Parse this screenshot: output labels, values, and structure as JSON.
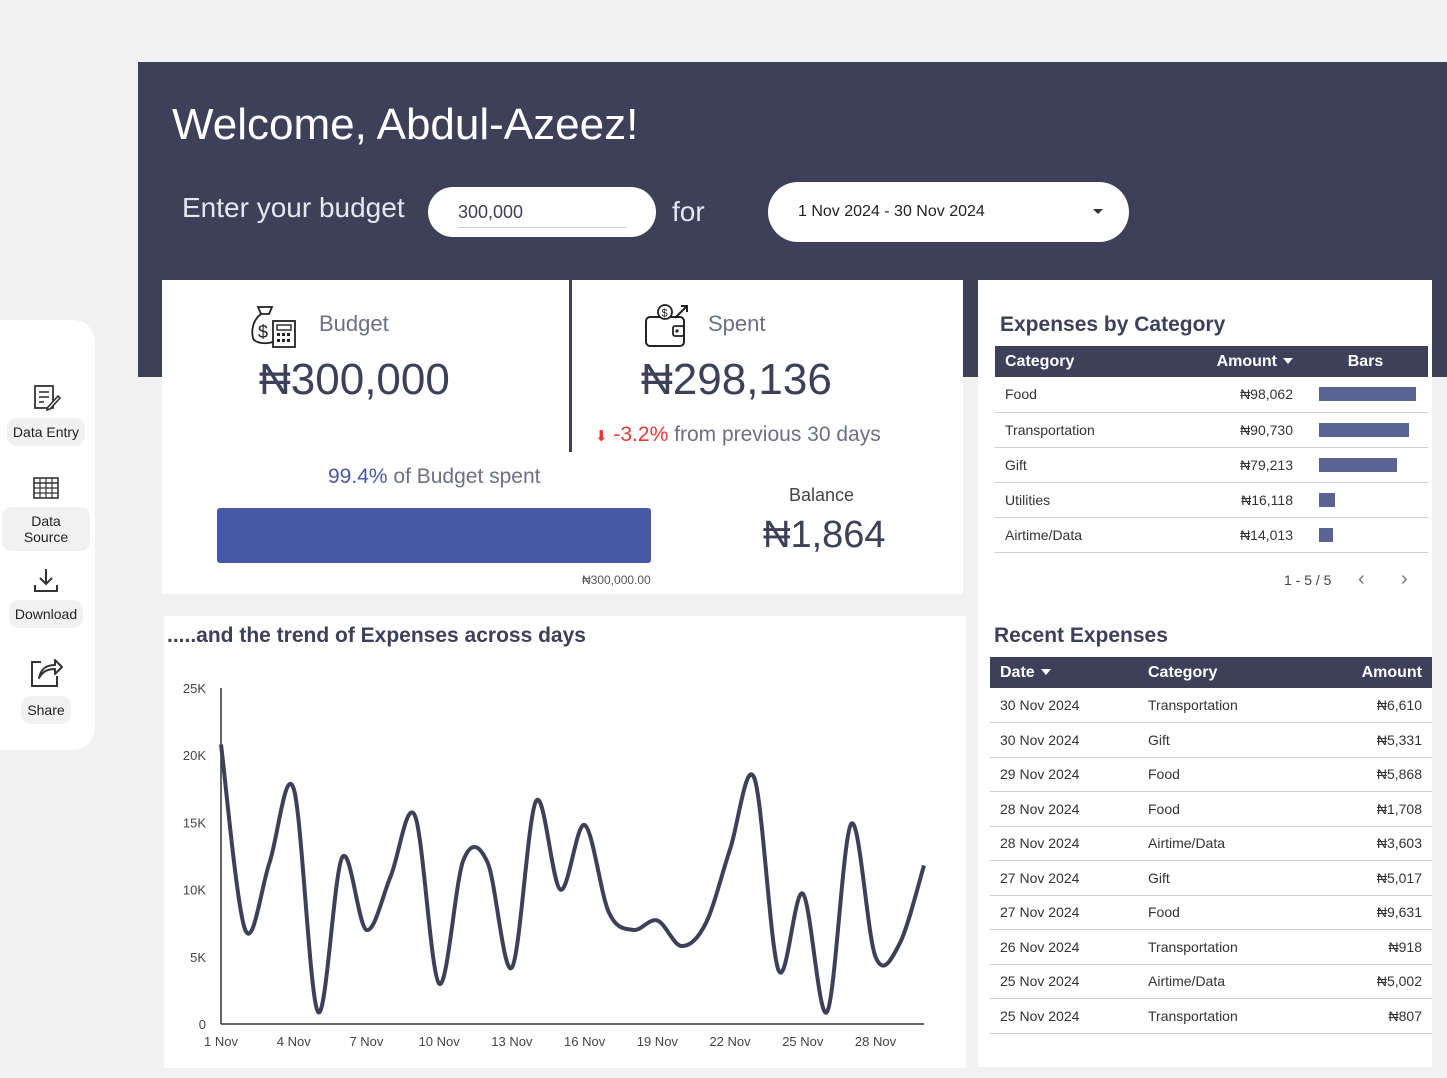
{
  "header": {
    "welcome": "Welcome, Abdul-Azeez!",
    "budget_prompt": "Enter your budget",
    "budget_value": "300,000",
    "for_label": "for",
    "date_range": "1 Nov 2024 - 30 Nov 2024"
  },
  "sidebar": {
    "items": [
      {
        "label": "Data Entry",
        "icon": "data-entry-icon"
      },
      {
        "label": "Data Source",
        "icon": "table-icon"
      },
      {
        "label": "Download",
        "icon": "download-icon"
      },
      {
        "label": "Share",
        "icon": "share-icon"
      }
    ]
  },
  "kpi": {
    "budget_label": "Budget",
    "budget_value": "₦300,000",
    "spent_label": "Spent",
    "spent_value": "₦298,136",
    "change_pct": "-3.2%",
    "change_text": "from previous 30 days",
    "budget_spent_pct": "99.4%",
    "budget_spent_text": "of Budget spent",
    "budget_spent_fraction": 0.994,
    "progress_max": "₦300,000.00",
    "balance_label": "Balance",
    "balance_value": "₦1,864",
    "colors": {
      "accent": "#3c4059",
      "progress": "#4758a5",
      "negative": "#e53935"
    }
  },
  "expenses_by_category": {
    "title": "Expenses by Category",
    "columns": [
      "Category",
      "Amount",
      "Bars"
    ],
    "rows": [
      {
        "category": "Food",
        "amount": "₦98,062",
        "value": 98062
      },
      {
        "category": "Transportation",
        "amount": "₦90,730",
        "value": 90730
      },
      {
        "category": "Gift",
        "amount": "₦79,213",
        "value": 79213
      },
      {
        "category": "Utilities",
        "amount": "₦16,118",
        "value": 16118
      },
      {
        "category": "Airtime/Data",
        "amount": "₦14,013",
        "value": 14013
      }
    ],
    "pager": "1 - 5 / 5"
  },
  "recent_expenses": {
    "title": "Recent Expenses",
    "columns": [
      "Date",
      "Category",
      "Amount"
    ],
    "rows": [
      {
        "date": "30 Nov 2024",
        "category": "Transportation",
        "amount": "₦6,610"
      },
      {
        "date": "30 Nov 2024",
        "category": "Gift",
        "amount": "₦5,331"
      },
      {
        "date": "29 Nov 2024",
        "category": "Food",
        "amount": "₦5,868"
      },
      {
        "date": "28 Nov 2024",
        "category": "Food",
        "amount": "₦1,708"
      },
      {
        "date": "28 Nov 2024",
        "category": "Airtime/Data",
        "amount": "₦3,603"
      },
      {
        "date": "27 Nov 2024",
        "category": "Gift",
        "amount": "₦5,017"
      },
      {
        "date": "27 Nov 2024",
        "category": "Food",
        "amount": "₦9,631"
      },
      {
        "date": "26 Nov 2024",
        "category": "Transportation",
        "amount": "₦918"
      },
      {
        "date": "25 Nov 2024",
        "category": "Airtime/Data",
        "amount": "₦5,002"
      },
      {
        "date": "25 Nov 2024",
        "category": "Transportation",
        "amount": "₦807"
      }
    ]
  },
  "trend": {
    "title": ".....and the trend of Expenses across days"
  },
  "chart_data": {
    "type": "line",
    "title": ".....and the trend of Expenses across days",
    "xlabel": "",
    "ylabel": "",
    "ylim": [
      0,
      25000
    ],
    "yticks": [
      "0",
      "5K",
      "10K",
      "15K",
      "20K",
      "25K"
    ],
    "xticks": [
      "1 Nov",
      "4 Nov",
      "7 Nov",
      "10 Nov",
      "13 Nov",
      "16 Nov",
      "19 Nov",
      "22 Nov",
      "25 Nov",
      "28 Nov"
    ],
    "x": [
      "1 Nov",
      "2 Nov",
      "3 Nov",
      "4 Nov",
      "5 Nov",
      "6 Nov",
      "7 Nov",
      "8 Nov",
      "9 Nov",
      "10 Nov",
      "11 Nov",
      "12 Nov",
      "13 Nov",
      "14 Nov",
      "15 Nov",
      "16 Nov",
      "17 Nov",
      "18 Nov",
      "19 Nov",
      "20 Nov",
      "21 Nov",
      "22 Nov",
      "23 Nov",
      "24 Nov",
      "25 Nov",
      "26 Nov",
      "27 Nov",
      "28 Nov",
      "29 Nov",
      "30 Nov"
    ],
    "series": [
      {
        "values": [
          20800,
          7000,
          12000,
          17500,
          900,
          12400,
          7000,
          11000,
          15500,
          3000,
          12200,
          12000,
          4200,
          16600,
          10000,
          14800,
          8300,
          7000,
          7700,
          5800,
          7500,
          13000,
          18300,
          4000,
          9700,
          900,
          14900,
          5000,
          6000,
          11800
        ]
      }
    ],
    "grid": false,
    "line_color": "#3c4059"
  }
}
